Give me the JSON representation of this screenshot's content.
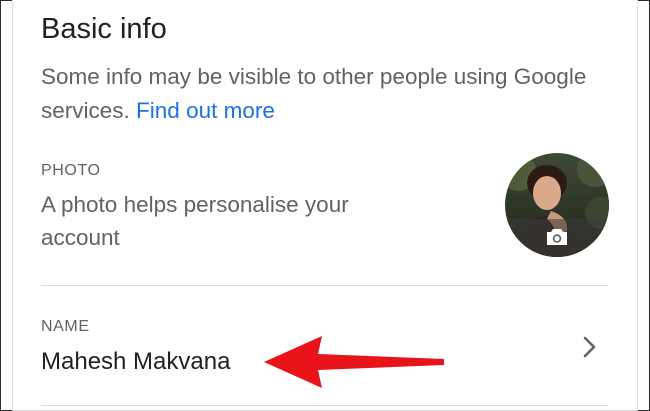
{
  "section": {
    "title": "Basic info",
    "description": "Some info may be visible to other people using Google services.",
    "link_text": "Find out more"
  },
  "photo": {
    "label": "PHOTO",
    "description": "A photo helps personalise your account",
    "camera_icon": "camera-icon"
  },
  "name": {
    "label": "NAME",
    "value": "Mahesh Makvana",
    "chevron_icon": "chevron-right-icon"
  },
  "annotation": {
    "arrow_color": "#e8141a"
  },
  "colors": {
    "link": "#1a73e8",
    "primary_text": "#202124",
    "secondary_text": "#5f6368",
    "divider": "#dadce0"
  }
}
